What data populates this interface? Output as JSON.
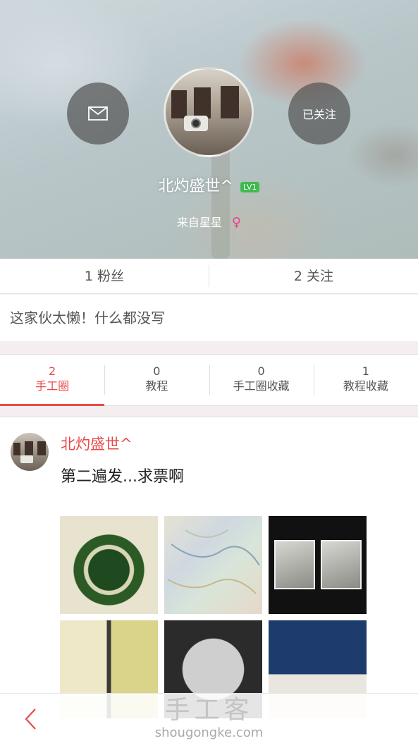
{
  "profile": {
    "username": "北灼盛世^",
    "level": "LV1",
    "location": "来自星星",
    "gender_symbol": "♀"
  },
  "actions": {
    "follow_label": "已关注"
  },
  "stats": {
    "fans": "1 粉丝",
    "following": "2 关注"
  },
  "bio": "这家伙太懒！什么都没写",
  "tabs": [
    {
      "count": "2",
      "label": "手工圈"
    },
    {
      "count": "0",
      "label": "教程"
    },
    {
      "count": "0",
      "label": "手工圈收藏"
    },
    {
      "count": "1",
      "label": "教程收藏"
    }
  ],
  "post": {
    "author": "北灼盛世^",
    "text": "第二遍发...求票啊"
  },
  "watermark": {
    "main": "手工客",
    "sub": "shougongke.com"
  },
  "colors": {
    "accent": "#e84a4a",
    "level_badge": "#3fbf4f",
    "gender": "#ea3f8d"
  },
  "icons": [
    "envelope-icon",
    "back-arrow-icon"
  ]
}
